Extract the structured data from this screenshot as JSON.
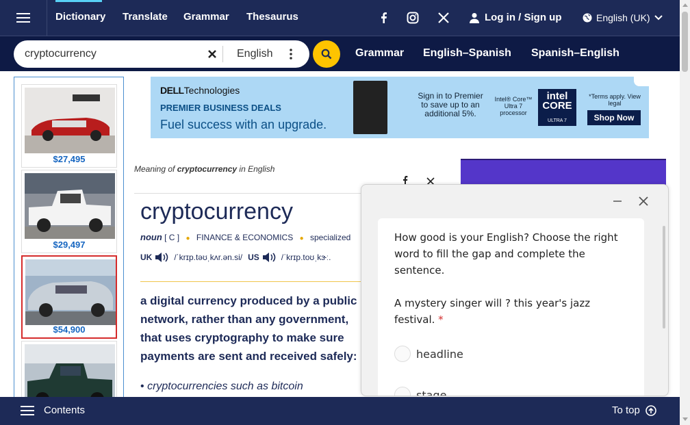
{
  "nav": {
    "links": [
      "Dictionary",
      "Translate",
      "Grammar",
      "Thesaurus"
    ],
    "login_label": "Log in / Sign up",
    "language_label": "English (UK)"
  },
  "search": {
    "query": "cryptocurrency",
    "dictionary_language": "English",
    "quick_links": [
      "Grammar",
      "English–Spanish",
      "Spanish–English"
    ]
  },
  "car_ads": [
    {
      "price": "$27,495"
    },
    {
      "price": "$29,497"
    },
    {
      "price": "$54,900"
    },
    {
      "price": ""
    }
  ],
  "banner_ad": {
    "brand_bold": "DELL",
    "brand_rest": "Technologies",
    "headline": "PREMIER BUSINESS DEALS",
    "tagline": "Fuel success with an upgrade.",
    "offer": "Sign in to Premier to save up to an additional 5%.",
    "processor": "Intel® Core™ Ultra 7 processor",
    "badge_line1": "intel",
    "badge_line2": "CORE",
    "badge_line3": "ULTRA 7",
    "terms": "*Terms apply. View legal",
    "cta": "Shop Now"
  },
  "entry": {
    "meaning_prefix": "Meaning of ",
    "meaning_word": "cryptocurrency",
    "meaning_suffix": " in English",
    "headword": "cryptocurrency",
    "pos": "noun",
    "grammar": "[ C ]",
    "domain": "FINANCE & ECONOMICS",
    "register": "specialized",
    "uk_label": "UK",
    "uk_ipa": "/ˈkrɪp.təʊˌkʌr.ən.si/",
    "us_label": "US",
    "us_ipa": "/ˈkrɪp.toʊˌkɝː.",
    "definition": "a digital currency produced by a public network, rather than any government, that uses cryptography to make sure payments are sent and received safely:",
    "example_bullet": "•",
    "example": "cryptocurrencies such as bitcoin"
  },
  "quiz": {
    "intro": "How good is your English? Choose the right word to fill the gap and complete the sentence.",
    "question": "A mystery singer will ? this year's jazz festival.",
    "required_mark": "*",
    "options": [
      "headline",
      "stage"
    ]
  },
  "bottom": {
    "contents_label": "Contents",
    "totop_label": "To top"
  }
}
